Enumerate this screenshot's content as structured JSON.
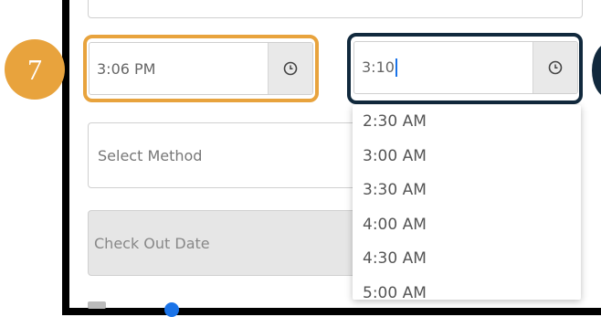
{
  "step_badge": "7",
  "start_time": {
    "value": "3:06 PM",
    "icon": "clock-icon"
  },
  "end_time": {
    "value": "3:10",
    "icon": "clock-icon"
  },
  "method_select": {
    "placeholder": "Select Method"
  },
  "checkout_date": {
    "placeholder": "Check Out Date"
  },
  "time_options": [
    "2:30 AM",
    "3:00 AM",
    "3:30 AM",
    "4:00 AM",
    "4:30 AM",
    "5:00 AM"
  ],
  "colors": {
    "highlight_orange": "#e8a33d",
    "highlight_navy": "#11293d",
    "caret": "#1a73e8"
  }
}
